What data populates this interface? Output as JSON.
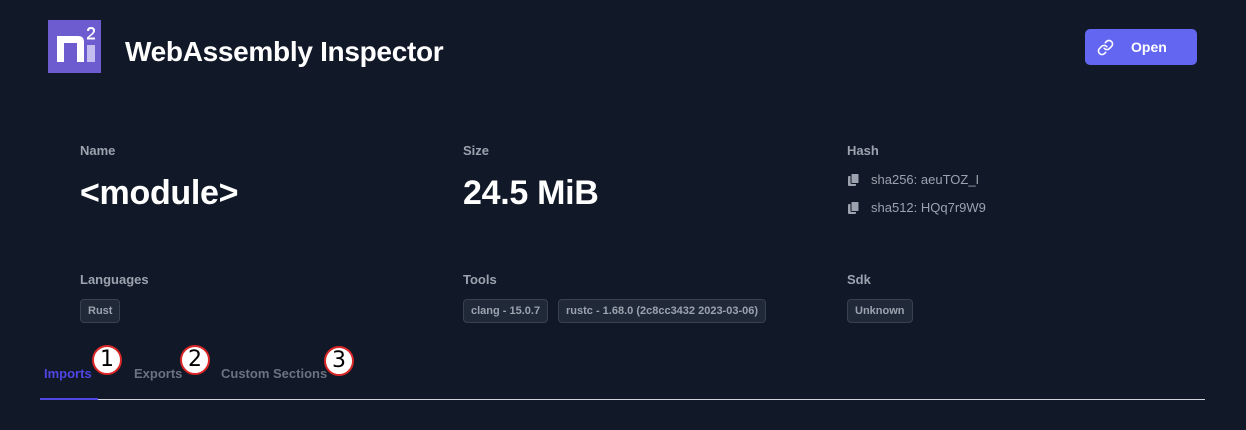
{
  "header": {
    "logo_icon": "n2-logo-icon",
    "title": "WebAssembly Inspector",
    "open_button": {
      "label": "Open",
      "icon": "link-icon"
    },
    "accent_color": "#6366f1"
  },
  "module": {
    "name_label": "Name",
    "name_value": "<module>",
    "size_label": "Size",
    "size_value": "24.5 MiB",
    "hash_label": "Hash",
    "hashes": [
      {
        "text": "sha256: aeuTOZ_I",
        "icon": "copy-icon"
      },
      {
        "text": "sha512: HQq7r9W9",
        "icon": "copy-icon"
      }
    ]
  },
  "meta": {
    "languages_label": "Languages",
    "languages": [
      "Rust"
    ],
    "tools_label": "Tools",
    "tools": [
      "clang - 15.0.7",
      "rustc - 1.68.0 (2c8cc3432 2023-03-06)"
    ],
    "sdk_label": "Sdk",
    "sdk": [
      "Unknown"
    ]
  },
  "tabs": {
    "items": [
      {
        "label": "Imports",
        "active": true,
        "marker": "1"
      },
      {
        "label": "Exports",
        "active": false,
        "marker": "2"
      },
      {
        "label": "Custom Sections",
        "active": false,
        "marker": "3"
      }
    ]
  }
}
